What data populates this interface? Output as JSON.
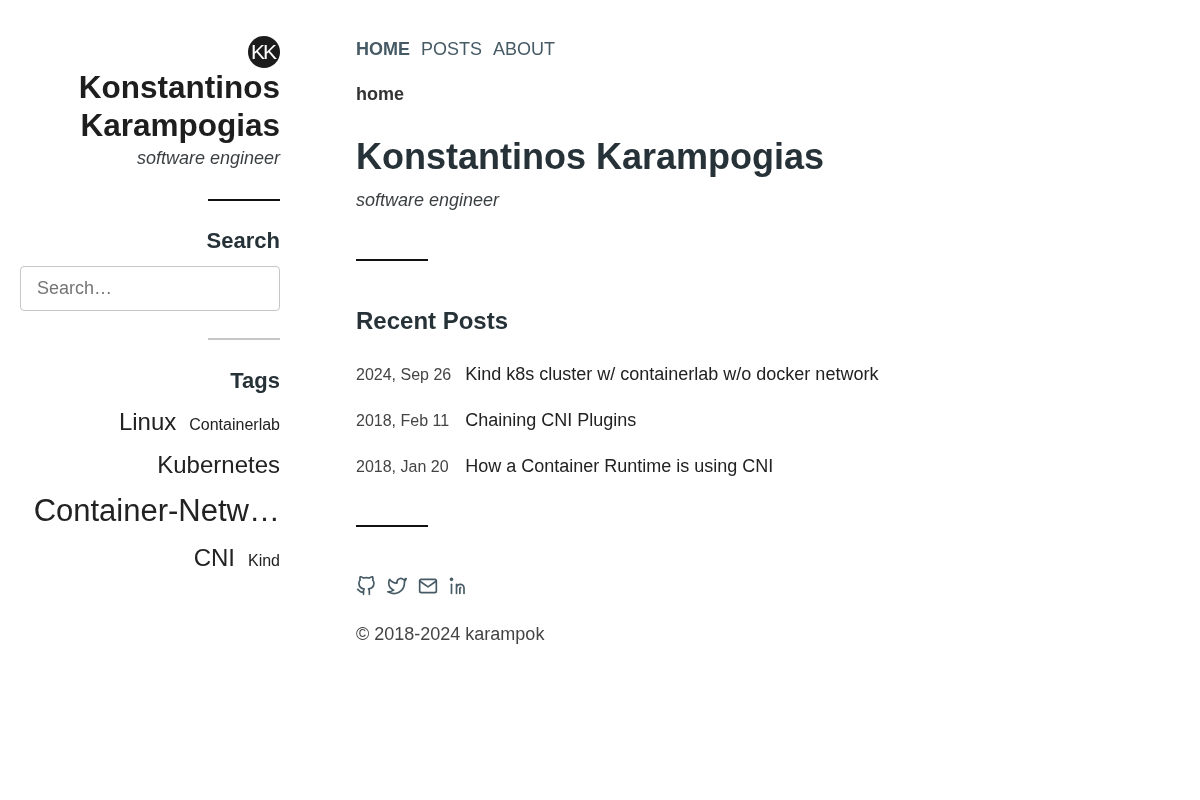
{
  "sidebar": {
    "avatar": {
      "initials": "KK"
    },
    "name": "Konstantinos Karampogias",
    "subtitle": "software engineer",
    "search": {
      "title": "Search",
      "placeholder": "Search…"
    },
    "tags": {
      "title": "Tags",
      "items": [
        {
          "label": "Linux",
          "kind": "large"
        },
        {
          "label": "Containerlab",
          "kind": "small"
        },
        {
          "label": "Kubernetes",
          "kind": "large"
        },
        {
          "label": "Container-Netw…",
          "kind": "xlarge"
        },
        {
          "label": "CNI",
          "kind": "large"
        },
        {
          "label": "Kind",
          "kind": "small"
        }
      ]
    }
  },
  "nav": [
    {
      "label": "HOME",
      "selected": true
    },
    {
      "label": "POSTS",
      "selected": false
    },
    {
      "label": "ABOUT",
      "selected": false
    }
  ],
  "breadcrumb": "home",
  "page": {
    "title": "Konstantinos Karampogias",
    "subtitle": "software engineer"
  },
  "recent_posts": {
    "title": "Recent Posts",
    "posts": [
      {
        "date": "2024, Sep 26",
        "title": "Kind k8s cluster w/ containerlab w/o docker network"
      },
      {
        "date": "2018, Feb 11",
        "title": "Chaining CNI Plugins"
      },
      {
        "date": "2018, Jan 20",
        "title": "How a Container Runtime is using CNI"
      }
    ]
  },
  "social_links": [
    {
      "kind": "github"
    },
    {
      "kind": "twitter"
    },
    {
      "kind": "mail"
    },
    {
      "kind": "linkedin"
    }
  ],
  "copyright": "© 2018-2024 karampok"
}
